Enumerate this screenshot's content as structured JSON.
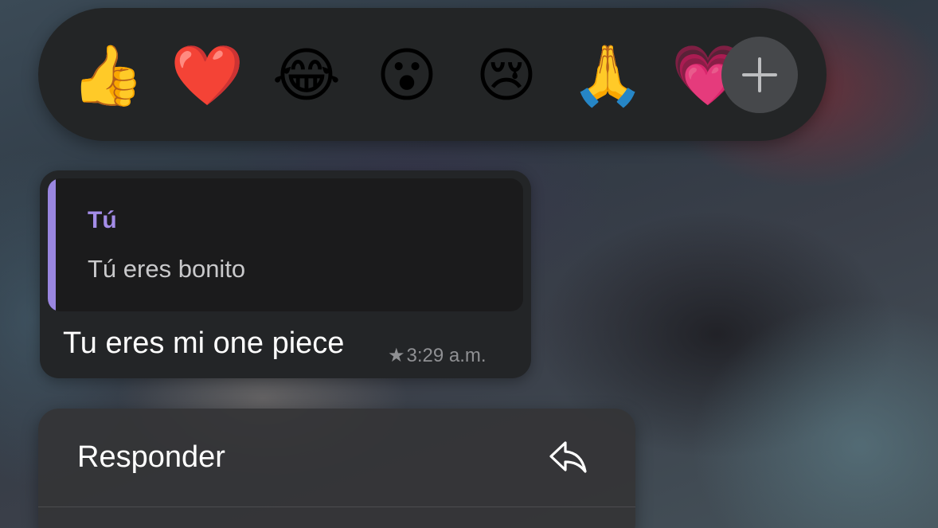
{
  "reactions": {
    "emojis": [
      "👍",
      "❤️",
      "😂",
      "😮",
      "😢",
      "🙏",
      "💗"
    ],
    "add_icon": "plus-icon"
  },
  "message": {
    "quote_author": "Tú",
    "quote_text": "Tú eres bonito",
    "text": "Tu eres mi one piece",
    "star": "★",
    "time": "3:29 a.m."
  },
  "menu": {
    "items": [
      {
        "label": "Responder",
        "icon": "reply-icon"
      }
    ]
  },
  "colors": {
    "quote_accent": "#9a86e0",
    "quote_author": "#a48de8",
    "bubble_bg": "#232527",
    "reaction_bar_bg": "#232526"
  }
}
